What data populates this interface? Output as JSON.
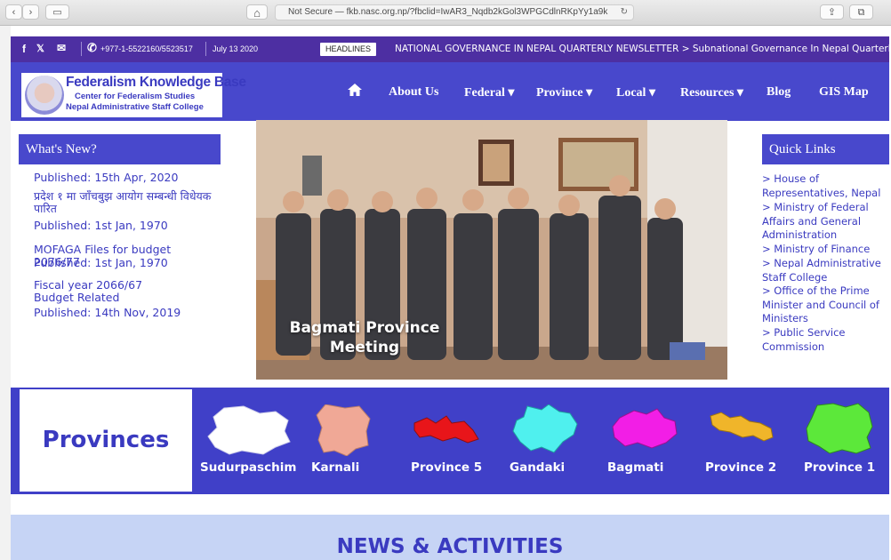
{
  "browser": {
    "url": "Not Secure — fkb.nasc.org.np/?fbclid=IwAR3_Nqdb2kGol3WPGCdlnRKpYy1a9k",
    "reload_icon": "reload-icon",
    "back_glyph": "‹",
    "forward_glyph": "›",
    "sidebar_glyph": "▭",
    "home_glyph": "⌂",
    "share_glyph": "⇪",
    "tabs_glyph": "⧉"
  },
  "topbar": {
    "phone": "+977-1-5522160/5523517",
    "date": "July 13 2020",
    "headlines_label": "HEADLINES",
    "ticker": "NATIONAL GOVERNANCE IN NEPAL QUARTERLY NEWSLETTER   >  Subnational Governance In Nepal Quarterl",
    "facebook_glyph": "f",
    "twitter_glyph": "🐦",
    "mail_glyph": "✉",
    "phone_glyph": "✆"
  },
  "logo": {
    "title": "Federalism Knowledge Base",
    "subtitle1": "Center for Federalism Studies",
    "subtitle2": "Nepal Administrative Staff College"
  },
  "nav": {
    "items": [
      "About Us",
      "Federal ▾",
      "Province ▾",
      "Local ▾",
      "Resources ▾",
      "Blog",
      "GIS Map"
    ]
  },
  "whats_new": {
    "header": "What's New?",
    "items": [
      {
        "title": "",
        "published": "Published: 15th Apr, 2020"
      },
      {
        "title": "प्रदेश १ मा जाँचबुझ आयोग सम्बन्धी विधेयक पारित",
        "published": "Published: 1st Jan, 1970"
      },
      {
        "title": "MOFAGA Files for budget 2076/77",
        "published": "Published: 1st Jan, 1970"
      },
      {
        "title": "Fiscal year 2066/67 Budget Related",
        "published": "Published: 14th Nov, 2019"
      }
    ]
  },
  "carousel": {
    "caption": "Bagmati Province Meeting"
  },
  "quick_links": {
    "header": "Quick Links",
    "items": [
      "> House of Representatives, Nepal",
      "> Ministry of Federal Affairs and General Administration",
      "> Ministry of Finance",
      "> Nepal Administrative Staff College",
      "> Office of the Prime Minister and Council of Ministers",
      "> Public Service Commission"
    ]
  },
  "provinces": {
    "title": "Provinces",
    "items": [
      {
        "name": "Sudurpaschim",
        "color": "#ffffff"
      },
      {
        "name": "Karnali",
        "color": "#f0a896"
      },
      {
        "name": "Province 5",
        "color": "#e8151a"
      },
      {
        "name": "Gandaki",
        "color": "#4ff0ee"
      },
      {
        "name": "Bagmati",
        "color": "#f21ee6"
      },
      {
        "name": "Province 2",
        "color": "#f0b52a"
      },
      {
        "name": "Province 1",
        "color": "#5ce83a"
      }
    ]
  },
  "news_activities": {
    "title": "NEWS & ACTIVITIES"
  },
  "colors": {
    "primary": "#4848cc",
    "topbar": "#4d2fa2",
    "link": "#3a3ac0"
  }
}
